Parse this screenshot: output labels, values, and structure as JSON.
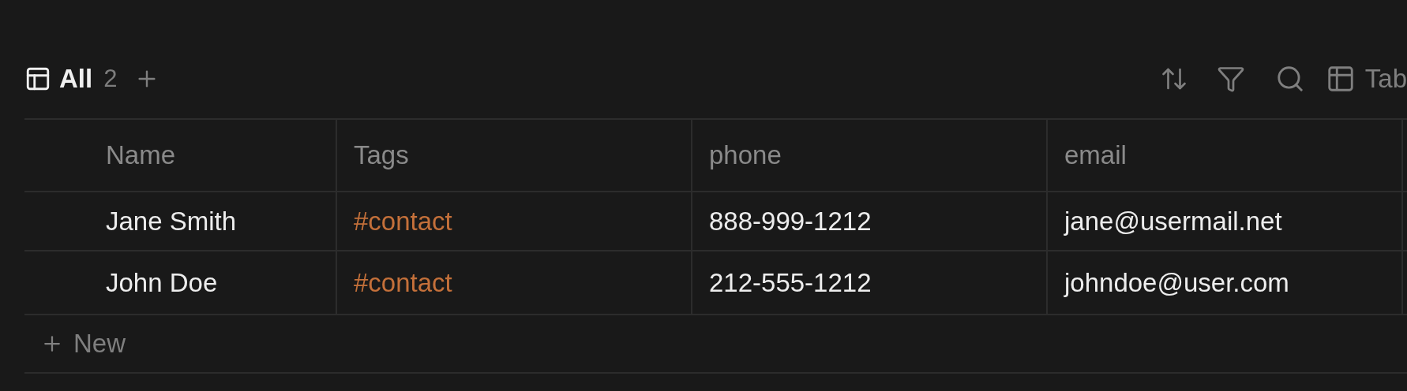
{
  "views": [
    {
      "label": "All",
      "count": "2",
      "selected": true
    }
  ],
  "toolbar": {
    "layout_label": "Tab"
  },
  "table": {
    "columns": [
      {
        "label": "Name",
        "kind": "title"
      },
      {
        "label": "Tags",
        "kind": "tag"
      },
      {
        "label": "phone",
        "kind": "text"
      },
      {
        "label": "email",
        "kind": "text"
      }
    ],
    "rows": [
      [
        "Jane Smith",
        "#contact",
        "888-999-1212",
        "jane@usermail.net"
      ],
      [
        "John Doe",
        "#contact",
        "212-555-1212",
        "johndoe@user.com"
      ]
    ],
    "new_row_label": "New"
  }
}
